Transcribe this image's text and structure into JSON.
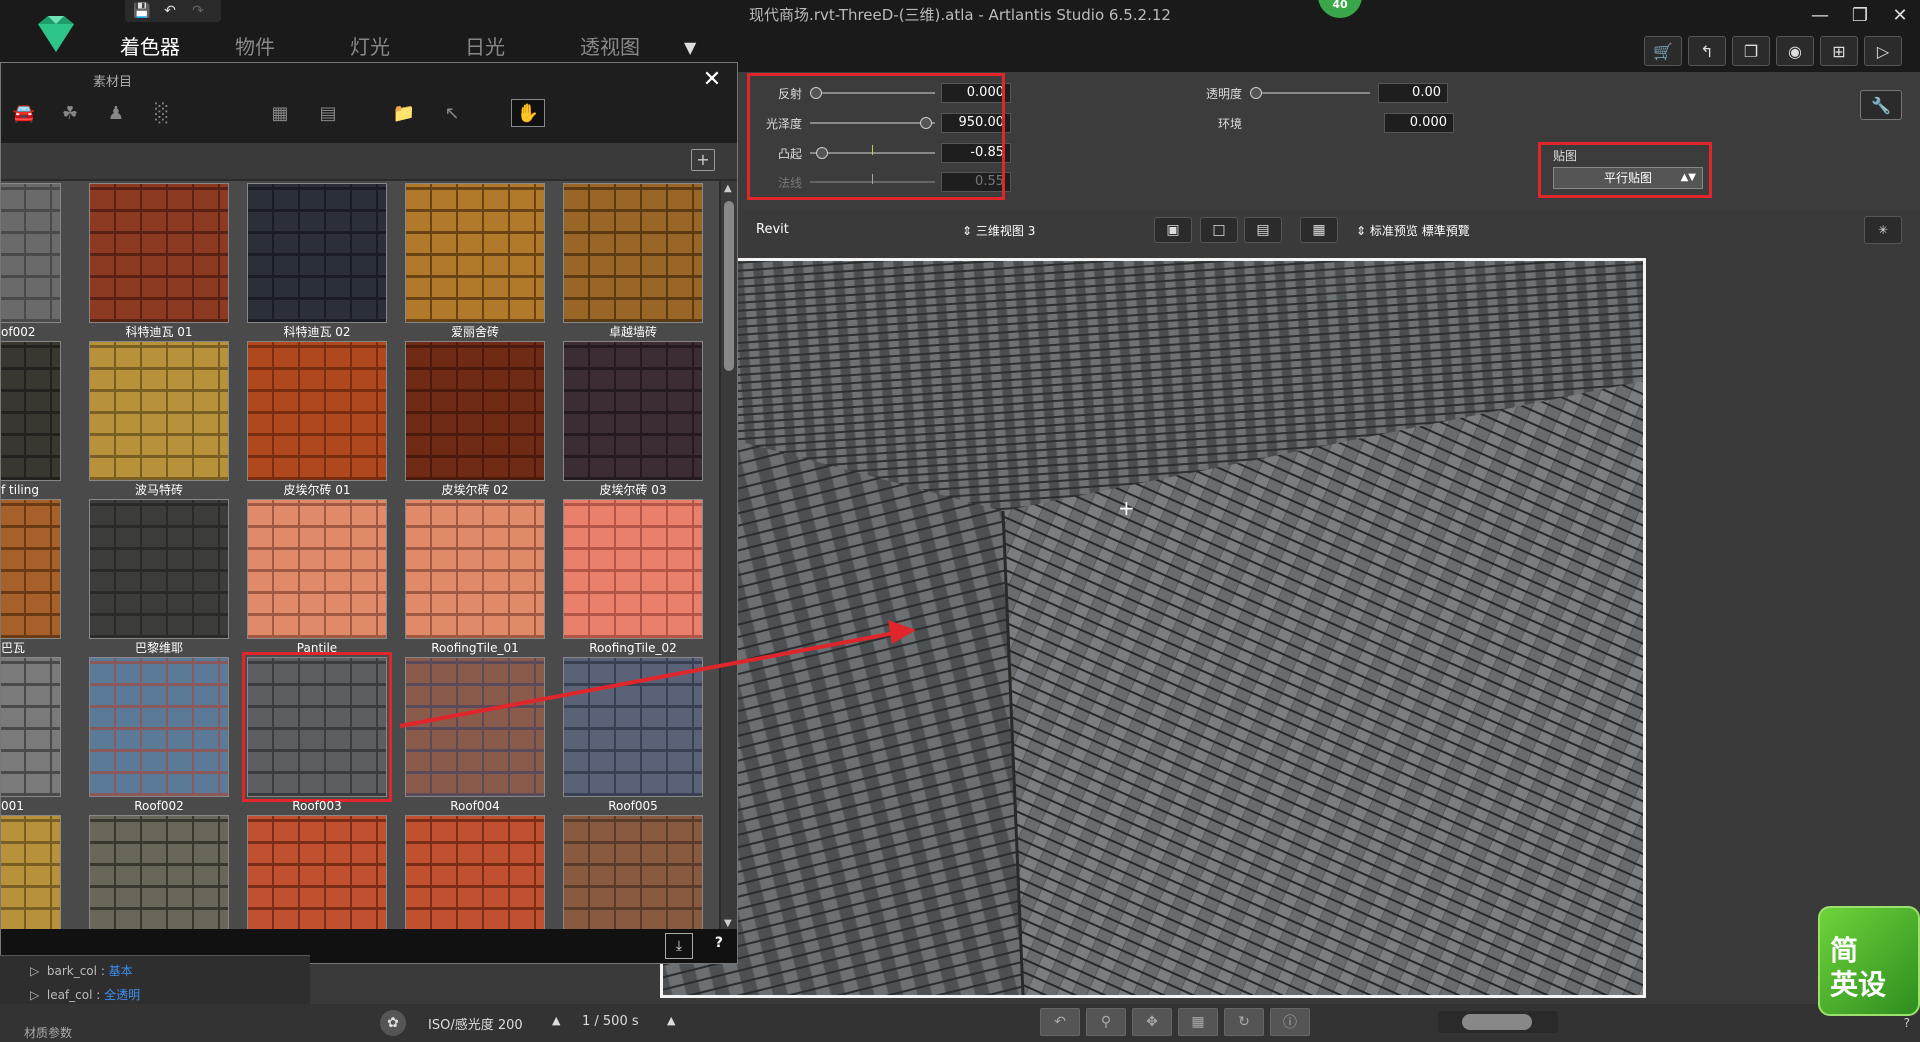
{
  "window": {
    "title": "现代商场.rvt-ThreeD-(三维).atla - Artlantis Studio 6.5.2.12",
    "badge": "40"
  },
  "quick_access": {
    "save_icon": "save-icon",
    "undo_icon": "undo-icon",
    "redo_icon": "redo-icon"
  },
  "main_tabs": [
    {
      "label": "着色器",
      "active": true
    },
    {
      "label": "物件",
      "active": false
    },
    {
      "label": "灯光",
      "active": false
    },
    {
      "label": "日光",
      "active": false
    },
    {
      "label": "透视图",
      "active": false
    }
  ],
  "params": {
    "reflection": {
      "label": "反射",
      "value": "0.000",
      "level": 0.0
    },
    "gloss": {
      "label": "光泽度",
      "value": "950.00",
      "level": 0.95
    },
    "bump": {
      "label": "凸起",
      "value": "-0.85",
      "level": 0.05
    },
    "normal": {
      "label": "法线",
      "value": "0.55",
      "disabled": true
    },
    "transparency": {
      "label": "透明度",
      "value": "0.00",
      "level": 0.0
    },
    "ambient": {
      "label": "环境",
      "value": "0.000"
    },
    "mapping": {
      "label": "贴图",
      "selected": "平行贴图"
    }
  },
  "view_toolbar": {
    "source": "Revit",
    "view": "三维视图 3",
    "preview_mode": "标准预览 標準預覽"
  },
  "library": {
    "title": "素材目",
    "tiles": [
      [
        {
          "label": "of002",
          "pattern": "slate-gray",
          "partial": true
        },
        {
          "label": "科特迪瓦 01",
          "pattern": "red-shingle"
        },
        {
          "label": "科特迪瓦 02",
          "pattern": "dark-shingle"
        },
        {
          "label": "爱丽舍砖",
          "pattern": "wood-shingle"
        },
        {
          "label": "卓越墙砖",
          "pattern": "brown-shingle"
        }
      ],
      [
        {
          "label": "f tiling",
          "pattern": "slate-dark",
          "partial": true
        },
        {
          "label": "波马特砖",
          "pattern": "tan-brick"
        },
        {
          "label": "皮埃尔砖 01",
          "pattern": "orange-brick"
        },
        {
          "label": "皮埃尔砖 02",
          "pattern": "dark-red-brick"
        },
        {
          "label": "皮埃尔砖 03",
          "pattern": "purple-brick"
        }
      ],
      [
        {
          "label": "巴瓦",
          "pattern": "orange-barrel",
          "partial": true
        },
        {
          "label": "巴黎维耶",
          "pattern": "gray-slate"
        },
        {
          "label": "Pantile",
          "pattern": "salmon-tile"
        },
        {
          "label": "RoofingTile_01",
          "pattern": "salmon-tile"
        },
        {
          "label": "RoofingTile_02",
          "pattern": "coral-tile"
        }
      ],
      [
        {
          "label": "001",
          "pattern": "gray-scale",
          "partial": true
        },
        {
          "label": "Roof002",
          "pattern": "blue-mix"
        },
        {
          "label": "Roof003",
          "pattern": "asphalt",
          "selected": true
        },
        {
          "label": "Roof004",
          "pattern": "rust-mix"
        },
        {
          "label": "Roof005",
          "pattern": "blue-scale"
        }
      ],
      [
        {
          "label": "",
          "pattern": "tan-brick",
          "partial": true
        },
        {
          "label": "",
          "pattern": "gray-barrel"
        },
        {
          "label": "",
          "pattern": "red-barrel"
        },
        {
          "label": "",
          "pattern": "red-barrel"
        },
        {
          "label": "",
          "pattern": "brown-barrel"
        }
      ]
    ]
  },
  "tree": [
    {
      "key": "bark_col",
      "value": "基本"
    },
    {
      "key": "leaf_col",
      "value": "全透明"
    }
  ],
  "material_params_label": "材质参数",
  "camera": {
    "iso": "ISO/感光度  200",
    "shutter": "1 /  500 s"
  },
  "watermark": {
    "line1": "简",
    "line2": "英设"
  },
  "help": "?",
  "colors": {
    "highlight": "#e0262b",
    "accent_green": "#3aa64a"
  }
}
